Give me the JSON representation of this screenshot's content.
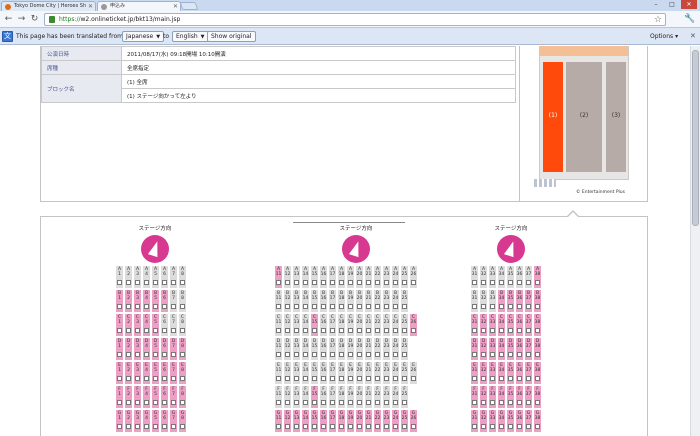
{
  "tabs": [
    {
      "title": "Tokyo Dome City | Heroes Sh",
      "active": false,
      "favicon_color": "#e06a1c"
    },
    {
      "title": "申込み",
      "active": true,
      "favicon_color": "#999999"
    }
  ],
  "icons": {
    "back": "←",
    "forward": "→",
    "reload": "↻",
    "star": "☆",
    "wrench": "🔧",
    "close": "✕",
    "translate": "文"
  },
  "address": {
    "protocol": "https://",
    "host": "w2.onlineticket.jp",
    "path": "/bkt13/main.jsp"
  },
  "translate_bar": {
    "message": "This page has been translated from",
    "from_lang": "Japanese",
    "to_label": "to",
    "to_lang": "English",
    "show_original": "Show original",
    "options": "Options"
  },
  "info": {
    "rows": [
      {
        "label": "公演日時",
        "value": "2011/08/17(水) 09:18開場 10:10開演"
      },
      {
        "label": "席種",
        "value": "全席指定"
      },
      {
        "label": "ブロック名",
        "value": "(1) 全席"
      },
      {
        "label": "",
        "value": "(1) ステージ向かって左より"
      }
    ]
  },
  "map": {
    "blocks": [
      {
        "label": "(1)",
        "color": "#ff4a0c",
        "label_color": "#ffffff"
      },
      {
        "label": "(2)",
        "color": "#b7aba7",
        "label_color": "#333333"
      },
      {
        "label": "(3)",
        "color": "#b7aba7",
        "label_color": "#333333"
      }
    ],
    "copyright": "© Entertainment Plus"
  },
  "stage_label": "ステージ方向",
  "colors": {
    "available": "#ee9fc6",
    "unavailable": "#dcdcdc",
    "arrow": "#d6398f"
  },
  "sections": [
    {
      "name": "left",
      "rows": [
        {
          "row": "A",
          "seats": [
            "1",
            "2",
            "3",
            "4",
            "5",
            "6",
            "7",
            "8"
          ],
          "avail": []
        },
        {
          "row": "B",
          "seats": [
            "1",
            "2",
            "3",
            "4",
            "5",
            "6",
            "7",
            "8"
          ],
          "avail": [
            "1",
            "2",
            "3",
            "4",
            "5",
            "6"
          ]
        },
        {
          "row": "C",
          "seats": [
            "1",
            "2",
            "3",
            "4",
            "5",
            "6",
            "7",
            "8"
          ],
          "avail": [
            "1",
            "2",
            "3",
            "4",
            "5"
          ]
        },
        {
          "row": "D",
          "seats": [
            "1",
            "2",
            "3",
            "4",
            "5",
            "6",
            "7",
            "8"
          ],
          "avail": [
            "1",
            "2",
            "3",
            "4",
            "5",
            "6",
            "7",
            "8"
          ]
        },
        {
          "row": "E",
          "seats": [
            "1",
            "2",
            "3",
            "4",
            "5",
            "6",
            "7",
            "8"
          ],
          "avail": [
            "1",
            "2",
            "3",
            "4",
            "5",
            "6",
            "7",
            "8"
          ]
        },
        {
          "row": "F",
          "seats": [
            "1",
            "2",
            "3",
            "4",
            "5",
            "6",
            "7",
            "8"
          ],
          "avail": [
            "1",
            "2",
            "3",
            "4",
            "5",
            "6",
            "7",
            "8"
          ]
        },
        {
          "row": "G",
          "seats": [
            "1",
            "2",
            "3",
            "4",
            "5",
            "6",
            "7",
            "8"
          ],
          "avail": [
            "1",
            "2",
            "3",
            "4",
            "5",
            "6",
            "7",
            "8"
          ]
        }
      ]
    },
    {
      "name": "center",
      "rows": [
        {
          "row": "A",
          "seats": [
            "11",
            "12",
            "13",
            "14",
            "15",
            "16",
            "17",
            "18",
            "19",
            "20",
            "21",
            "22",
            "23",
            "24",
            "25",
            "26"
          ],
          "avail": [
            "11"
          ]
        },
        {
          "row": "B",
          "seats": [
            "11",
            "12",
            "13",
            "14",
            "15",
            "16",
            "17",
            "18",
            "19",
            "20",
            "21",
            "22",
            "23",
            "24",
            "25"
          ],
          "avail": []
        },
        {
          "row": "C",
          "seats": [
            "11",
            "12",
            "13",
            "14",
            "15",
            "16",
            "17",
            "18",
            "19",
            "20",
            "21",
            "22",
            "23",
            "24",
            "25",
            "26"
          ],
          "avail": [
            "15",
            "26"
          ]
        },
        {
          "row": "D",
          "seats": [
            "11",
            "12",
            "13",
            "14",
            "15",
            "16",
            "17",
            "18",
            "19",
            "20",
            "21",
            "22",
            "23",
            "24",
            "25"
          ],
          "avail": []
        },
        {
          "row": "E",
          "seats": [
            "11",
            "12",
            "13",
            "14",
            "15",
            "16",
            "17",
            "18",
            "19",
            "20",
            "21",
            "22",
            "23",
            "24",
            "25",
            "26"
          ],
          "avail": []
        },
        {
          "row": "F",
          "seats": [
            "11",
            "12",
            "13",
            "14",
            "15",
            "16",
            "17",
            "18",
            "19",
            "20",
            "21",
            "22",
            "23",
            "24",
            "25"
          ],
          "avail": [
            "15"
          ]
        },
        {
          "row": "G",
          "seats": [
            "11",
            "12",
            "13",
            "14",
            "15",
            "16",
            "17",
            "18",
            "19",
            "20",
            "21",
            "22",
            "23",
            "24",
            "25",
            "26"
          ],
          "avail": [
            "11",
            "12",
            "13",
            "14",
            "15",
            "16",
            "17",
            "18",
            "19",
            "20",
            "21",
            "22",
            "23",
            "24",
            "25",
            "26"
          ]
        }
      ]
    },
    {
      "name": "right",
      "rows": [
        {
          "row": "A",
          "seats": [
            "31",
            "32",
            "33",
            "34",
            "35",
            "36",
            "37",
            "38"
          ],
          "avail": [
            "38"
          ]
        },
        {
          "row": "B",
          "seats": [
            "31",
            "32",
            "33",
            "34",
            "35",
            "36",
            "37",
            "38"
          ],
          "avail": [
            "34",
            "35",
            "36",
            "37",
            "38"
          ]
        },
        {
          "row": "C",
          "seats": [
            "31",
            "32",
            "33",
            "34",
            "35",
            "36",
            "37",
            "38"
          ],
          "avail": [
            "31",
            "32",
            "33",
            "34",
            "35",
            "36",
            "37",
            "38"
          ]
        },
        {
          "row": "D",
          "seats": [
            "31",
            "32",
            "33",
            "34",
            "35",
            "36",
            "37",
            "38"
          ],
          "avail": [
            "31",
            "32",
            "33",
            "34",
            "35",
            "36",
            "37",
            "38"
          ]
        },
        {
          "row": "E",
          "seats": [
            "31",
            "32",
            "33",
            "34",
            "35",
            "36",
            "37",
            "38"
          ],
          "avail": [
            "31",
            "32",
            "33",
            "34",
            "35",
            "36",
            "37",
            "38"
          ]
        },
        {
          "row": "F",
          "seats": [
            "31",
            "32",
            "33",
            "34",
            "35",
            "36",
            "37",
            "38"
          ],
          "avail": [
            "31",
            "32",
            "33",
            "34",
            "35",
            "36",
            "37",
            "38"
          ]
        },
        {
          "row": "G",
          "seats": [
            "31",
            "32",
            "33",
            "34",
            "35",
            "36",
            "37",
            "38"
          ],
          "avail": [
            "31",
            "32",
            "33",
            "34",
            "35",
            "36",
            "37",
            "38"
          ]
        }
      ]
    }
  ]
}
